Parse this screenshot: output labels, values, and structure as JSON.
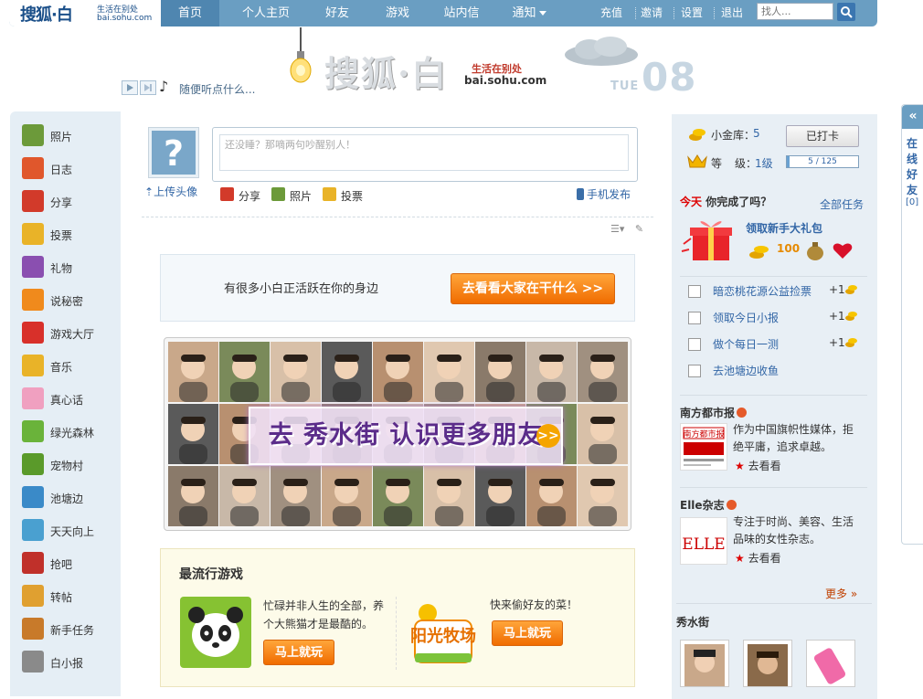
{
  "nav": {
    "logo_main": "搜狐·白",
    "logo_sub": "生活在别处",
    "logo_url": "bai.sohu.com",
    "items": [
      {
        "label": "首页",
        "active": true
      },
      {
        "label": "个人主页"
      },
      {
        "label": "好友"
      },
      {
        "label": "游戏"
      },
      {
        "label": "站内信"
      },
      {
        "label": "通知"
      }
    ],
    "right_links": [
      "充值",
      "邀请",
      "设置",
      "退出"
    ],
    "search_placeholder": "找人..."
  },
  "banner": {
    "player_text": "随便听点什么...",
    "brand": "搜狐·白",
    "brand_sub": "生活在别处",
    "brand_url": "bai.sohu.com",
    "day": "TUE",
    "date": "08"
  },
  "sidebar": {
    "items": [
      {
        "label": "照片",
        "icon": "photo-icon",
        "color": "#6c9a3a"
      },
      {
        "label": "日志",
        "icon": "journal-icon",
        "color": "#e0572c"
      },
      {
        "label": "分享",
        "icon": "share-heart-icon",
        "color": "#d23a2a"
      },
      {
        "label": "投票",
        "icon": "vote-chart-icon",
        "color": "#e9b328"
      },
      {
        "label": "礼物",
        "icon": "gift-icon",
        "color": "#8a4fb0"
      },
      {
        "label": "说秘密",
        "icon": "secret-icon",
        "color": "#f08a1c"
      },
      {
        "label": "游戏大厅",
        "icon": "dice-icon",
        "color": "#d8302a"
      },
      {
        "label": "音乐",
        "icon": "music-icon",
        "color": "#e9b328"
      },
      {
        "label": "真心话",
        "icon": "truth-icon",
        "color": "#f0a0c0"
      },
      {
        "label": "绿光森林",
        "icon": "forest-icon",
        "color": "#6ab33a"
      },
      {
        "label": "宠物村",
        "icon": "panda-icon",
        "color": "#5a9a2a"
      },
      {
        "label": "池塘边",
        "icon": "pond-icon",
        "color": "#3a8ac8"
      },
      {
        "label": "天天向上",
        "icon": "climb-icon",
        "color": "#4aa0d0"
      },
      {
        "label": "抢吧",
        "icon": "grab-icon",
        "color": "#c0302a"
      },
      {
        "label": "转帖",
        "icon": "repost-icon",
        "color": "#e0a030"
      },
      {
        "label": "新手任务",
        "icon": "newbie-icon",
        "color": "#c87a2a"
      },
      {
        "label": "白小报",
        "icon": "newspaper-icon",
        "color": "#8a8a8a"
      }
    ]
  },
  "status": {
    "upload_avatar": "上传头像",
    "placeholder": "还没睡？那嘀两句吵醒别人！",
    "actions": [
      {
        "label": "分享",
        "icon": "share-icon"
      },
      {
        "label": "照片",
        "icon": "photo-icon"
      },
      {
        "label": "投票",
        "icon": "vote-icon"
      }
    ],
    "mobile_publish": "手机发布"
  },
  "feed": {
    "active_text": "有很多小白正活跃在你的身边",
    "active_button": "去看看大家在干什么 >>",
    "photowall_text": "去 秀水街 认识更多朋友",
    "photowall_arrow": ">>"
  },
  "games": {
    "title": "最流行游戏",
    "items": [
      {
        "desc": "忙碌并非人生的全部，养个大熊猫才是最酷的。",
        "button": "马上就玩",
        "name": "panda"
      },
      {
        "desc": "快来偷好友的菜！",
        "button": "马上就玩",
        "name": "阳光牧场"
      }
    ]
  },
  "account": {
    "gold_label": "小金库：",
    "gold_value": "5",
    "checkin": "已打卡",
    "level_label_a": "等",
    "level_label_b": "级：",
    "level_value": "1级",
    "level_progress": "5 / 125",
    "level_fraction": 0.04
  },
  "tasks": {
    "today_prefix": "今天",
    "today_suffix": " 你完成了吗？",
    "all_tasks": "全部任务",
    "gift_title": "领取新手大礼包",
    "gift_reward": "100",
    "items": [
      {
        "label": "暗恋桃花源公益捡票",
        "points": "+1"
      },
      {
        "label": "领取今日小报",
        "points": "+1"
      },
      {
        "label": "做个每日一测",
        "points": "+1"
      },
      {
        "label": "去池塘边收鱼",
        "points": ""
      }
    ]
  },
  "feeds": [
    {
      "title": "南方都市报",
      "desc": "作为中国旗帜性媒体，拒绝平庸，追求卓越。",
      "link": "去看看",
      "logo": "南方都市报"
    },
    {
      "title": "Elle杂志",
      "desc": "专注于时尚、美容、生活品味的女性杂志。",
      "link": "去看看",
      "logo": "ELLE"
    }
  ],
  "right_more": "更多 »",
  "xiushui": {
    "title": "秀水街"
  },
  "online": {
    "label": "在线好友",
    "count": "[0]",
    "toggle": "«"
  },
  "colors": {
    "nav": "#6a9ec2",
    "accent_orange": "#f06c00",
    "link_blue": "#3266a6"
  }
}
